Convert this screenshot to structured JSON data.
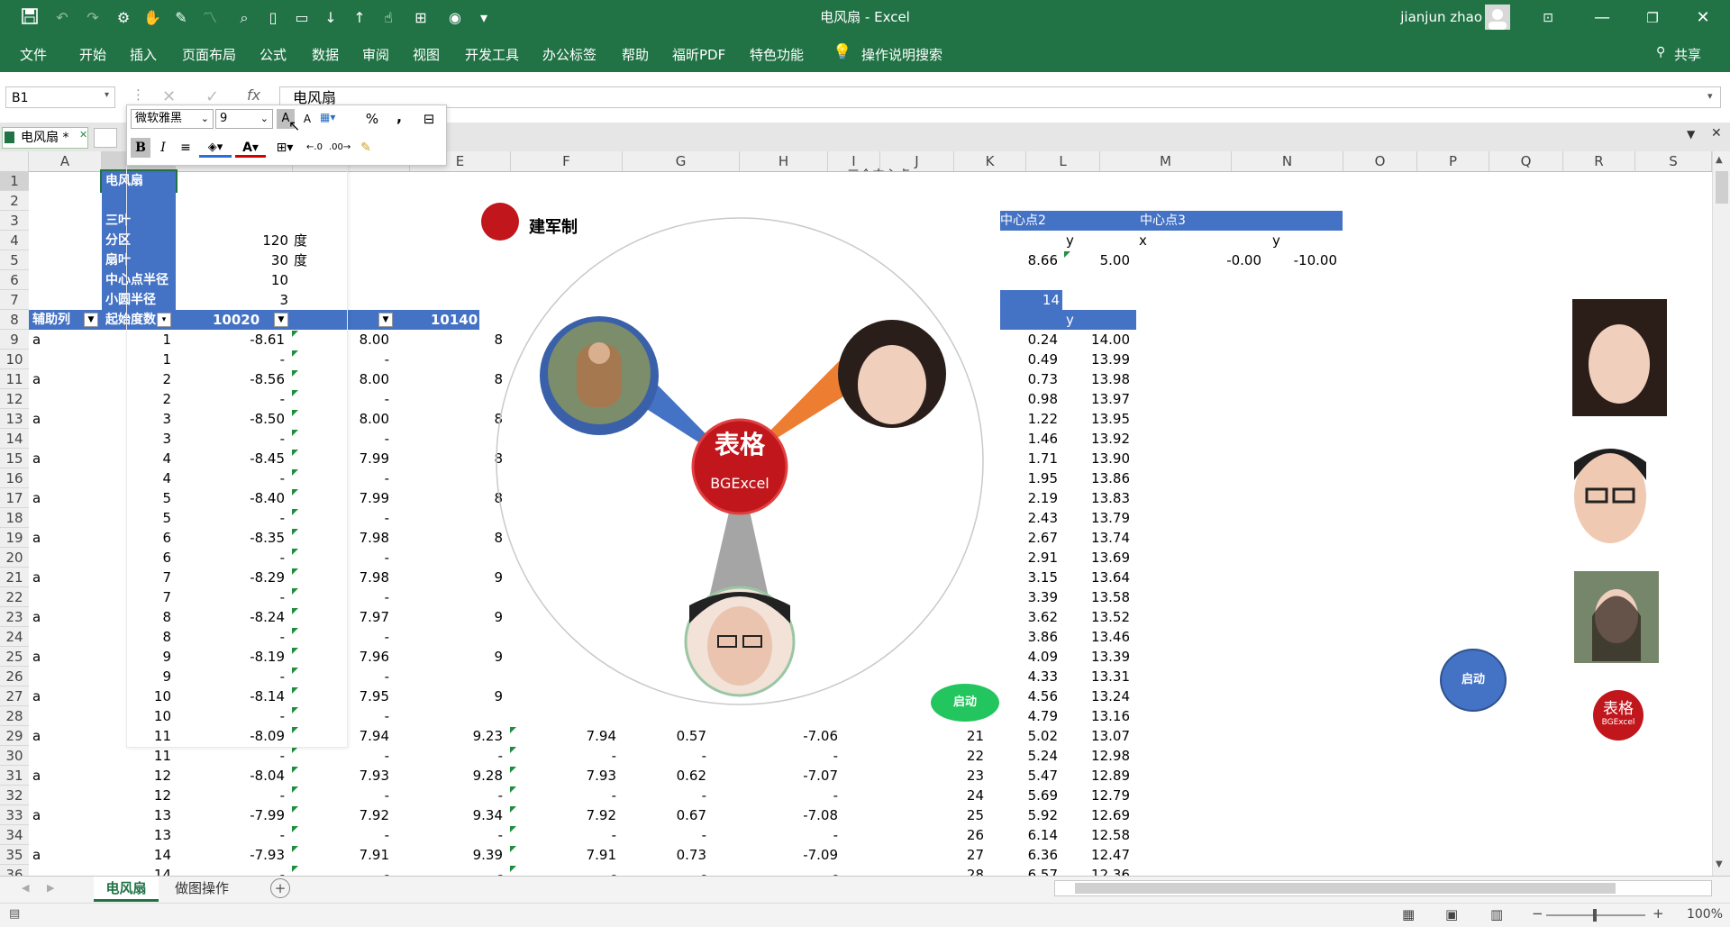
{
  "titlebar": {
    "title": "电风扇 - Excel",
    "user": "jianjun zhao"
  },
  "ribbon": {
    "tabs": [
      "文件",
      "开始",
      "插入",
      "页面布局",
      "公式",
      "数据",
      "审阅",
      "视图",
      "开发工具",
      "办公标签",
      "帮助",
      "福昕PDF",
      "特色功能"
    ],
    "search": "操作说明搜索",
    "share": "共享"
  },
  "formula_bar": {
    "name_box": "B1",
    "formula": "电风扇"
  },
  "workbook_tab": {
    "label": "电风扇 *"
  },
  "mini_toolbar": {
    "font": "微软雅黑",
    "size": "9",
    "percent": "%",
    "comma": ","
  },
  "columns": [
    "A",
    "B",
    "C",
    "D",
    "E",
    "F",
    "G",
    "H",
    "I",
    "J",
    "K",
    "L",
    "M",
    "N",
    "O",
    "P",
    "Q",
    "R",
    "S"
  ],
  "rows": [
    "1",
    "2",
    "3",
    "4",
    "5",
    "6",
    "7",
    "8",
    "9",
    "10",
    "11",
    "12",
    "13",
    "14",
    "15",
    "16",
    "17",
    "18",
    "19",
    "20",
    "21",
    "22",
    "23",
    "24",
    "25",
    "26",
    "27",
    "28",
    "29",
    "30",
    "31",
    "32",
    "33",
    "34",
    "35",
    "36"
  ],
  "cells": {
    "b1": "电风扇",
    "b3": "三叶",
    "b4": "分区",
    "b5": "扇叶",
    "b6": "中心点半径",
    "b7": "小圆半径",
    "c4": "120",
    "c5": "30",
    "c6": "10",
    "c7": "3",
    "unit": "度",
    "a8": "辅助列",
    "b8": "起始度数",
    "c8": "10020",
    "e8": "10140",
    "k3": "中心点2",
    "m3": "中心点3",
    "k4_y": "y",
    "m4_x": "x",
    "n4_y": "y",
    "k5": "8.66",
    "l5": "5.00",
    "m5": "-0.00",
    "n5": "-10.00",
    "k7": "14",
    "l8": "y",
    "ghost_title": "三个中心点",
    "chart_title": "建军制",
    "logo_text": "BGExcel",
    "start_button": "启动",
    "start_button2": "启动"
  },
  "data_rows": [
    {
      "a": "a",
      "b": "1",
      "c": "-8.61",
      "d": "8.00",
      "e": "8"
    },
    {
      "a": "",
      "b": "1",
      "c": "-",
      "d": "-",
      "e": ""
    },
    {
      "a": "a",
      "b": "2",
      "c": "-8.56",
      "d": "8.00",
      "e": "8"
    },
    {
      "a": "",
      "b": "2",
      "c": "-",
      "d": "-",
      "e": ""
    },
    {
      "a": "a",
      "b": "3",
      "c": "-8.50",
      "d": "8.00",
      "e": "8"
    },
    {
      "a": "",
      "b": "3",
      "c": "-",
      "d": "-",
      "e": ""
    },
    {
      "a": "a",
      "b": "4",
      "c": "-8.45",
      "d": "7.99",
      "e": "8"
    },
    {
      "a": "",
      "b": "4",
      "c": "-",
      "d": "-",
      "e": ""
    },
    {
      "a": "a",
      "b": "5",
      "c": "-8.40",
      "d": "7.99",
      "e": "8"
    },
    {
      "a": "",
      "b": "5",
      "c": "-",
      "d": "-",
      "e": ""
    },
    {
      "a": "a",
      "b": "6",
      "c": "-8.35",
      "d": "7.98",
      "e": "8"
    },
    {
      "a": "",
      "b": "6",
      "c": "-",
      "d": "-",
      "e": ""
    },
    {
      "a": "a",
      "b": "7",
      "c": "-8.29",
      "d": "7.98",
      "e": "9"
    },
    {
      "a": "",
      "b": "7",
      "c": "-",
      "d": "-",
      "e": ""
    },
    {
      "a": "a",
      "b": "8",
      "c": "-8.24",
      "d": "7.97",
      "e": "9"
    },
    {
      "a": "",
      "b": "8",
      "c": "-",
      "d": "-",
      "e": ""
    },
    {
      "a": "a",
      "b": "9",
      "c": "-8.19",
      "d": "7.96",
      "e": "9"
    },
    {
      "a": "",
      "b": "9",
      "c": "-",
      "d": "-",
      "e": ""
    },
    {
      "a": "a",
      "b": "10",
      "c": "-8.14",
      "d": "7.95",
      "e": "9"
    },
    {
      "a": "",
      "b": "10",
      "c": "-",
      "d": "-",
      "e": ""
    },
    {
      "a": "a",
      "b": "11",
      "c": "-8.09",
      "d": "7.94",
      "e": "9.23",
      "f": "7.94",
      "g": "0.57",
      "h": "-7.06",
      "j": "21"
    },
    {
      "a": "",
      "b": "11",
      "c": "-",
      "d": "-",
      "e": "-",
      "f": "-",
      "g": "-",
      "h": "-",
      "j": "22"
    },
    {
      "a": "a",
      "b": "12",
      "c": "-8.04",
      "d": "7.93",
      "e": "9.28",
      "f": "7.93",
      "g": "0.62",
      "h": "-7.07",
      "j": "23"
    },
    {
      "a": "",
      "b": "12",
      "c": "-",
      "d": "-",
      "e": "-",
      "f": "-",
      "g": "-",
      "h": "-",
      "j": "24"
    },
    {
      "a": "a",
      "b": "13",
      "c": "-7.99",
      "d": "7.92",
      "e": "9.34",
      "f": "7.92",
      "g": "0.67",
      "h": "-7.08",
      "j": "25"
    },
    {
      "a": "",
      "b": "13",
      "c": "-",
      "d": "-",
      "e": "-",
      "f": "-",
      "g": "-",
      "h": "-",
      "j": "26"
    },
    {
      "a": "a",
      "b": "14",
      "c": "-7.93",
      "d": "7.91",
      "e": "9.39",
      "f": "7.91",
      "g": "0.73",
      "h": "-7.09",
      "j": "27"
    },
    {
      "a": "",
      "b": "14",
      "c": "-",
      "d": "-",
      "e": "-",
      "f": "-",
      "g": "-",
      "h": "-",
      "j": "28"
    }
  ],
  "kl_rows": [
    [
      "0.24",
      "14.00"
    ],
    [
      "0.49",
      "13.99"
    ],
    [
      "0.73",
      "13.98"
    ],
    [
      "0.98",
      "13.97"
    ],
    [
      "1.22",
      "13.95"
    ],
    [
      "1.46",
      "13.92"
    ],
    [
      "1.71",
      "13.90"
    ],
    [
      "1.95",
      "13.86"
    ],
    [
      "2.19",
      "13.83"
    ],
    [
      "2.43",
      "13.79"
    ],
    [
      "2.67",
      "13.74"
    ],
    [
      "2.91",
      "13.69"
    ],
    [
      "3.15",
      "13.64"
    ],
    [
      "3.39",
      "13.58"
    ],
    [
      "3.62",
      "13.52"
    ],
    [
      "3.86",
      "13.46"
    ],
    [
      "4.09",
      "13.39"
    ],
    [
      "4.33",
      "13.31"
    ],
    [
      "4.56",
      "13.24"
    ],
    [
      "4.79",
      "13.16"
    ],
    [
      "5.02",
      "13.07"
    ],
    [
      "5.24",
      "12.98"
    ],
    [
      "5.47",
      "12.89"
    ],
    [
      "5.69",
      "12.79"
    ],
    [
      "5.92",
      "12.69"
    ],
    [
      "6.14",
      "12.58"
    ],
    [
      "6.36",
      "12.47"
    ],
    [
      "6.57",
      "12.36"
    ]
  ],
  "sheet_tabs": [
    "电风扇",
    "做图操作"
  ],
  "status": {
    "zoom": "100%"
  },
  "colors": {
    "excel_green": "#217346",
    "blue_fill": "#4472c4",
    "blade_blue": "#4472c4",
    "blade_orange": "#ed7d31",
    "blade_gray": "#a5a5a5",
    "logo_red": "#c0161c",
    "start_green": "#22c55e"
  }
}
